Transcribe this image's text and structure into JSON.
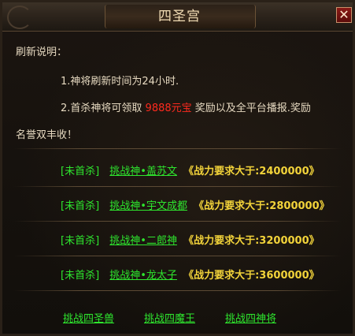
{
  "window": {
    "title": "四圣宫",
    "close_glyph": "✕"
  },
  "description": {
    "heading": "刷新说明：",
    "line1": "1.神将刷新时间为24小时.",
    "line2_prefix": "2.首杀神将可领取",
    "line2_reward": "9888元宝",
    "line2_suffix": "奖励以及全平台播报.奖励",
    "line3": "名誉双丰收！"
  },
  "challenges": [
    {
      "status": "[未首杀]",
      "link": "挑战神•盖苏文",
      "requirement": "《战力要求大于:2400000》"
    },
    {
      "status": "[未首杀]",
      "link": "挑战神•宇文成都",
      "requirement": "《战力要求大于:2800000》"
    },
    {
      "status": "[未首杀]",
      "link": "挑战神•二郎神",
      "requirement": "《战力要求大于:3200000》"
    },
    {
      "status": "[未首杀]",
      "link": "挑战神•龙太子",
      "requirement": "《战力要求大于:3600000》"
    }
  ],
  "buttons": {
    "beasts": "挑战四圣兽",
    "demons": "挑战四魔王",
    "generals": "挑战四神将"
  },
  "colors": {
    "accent_green": "#2ee62e",
    "reward_red": "#ff2a1e",
    "requirement_yellow": "#f2d33a",
    "text_cream": "#e6d9c0"
  }
}
